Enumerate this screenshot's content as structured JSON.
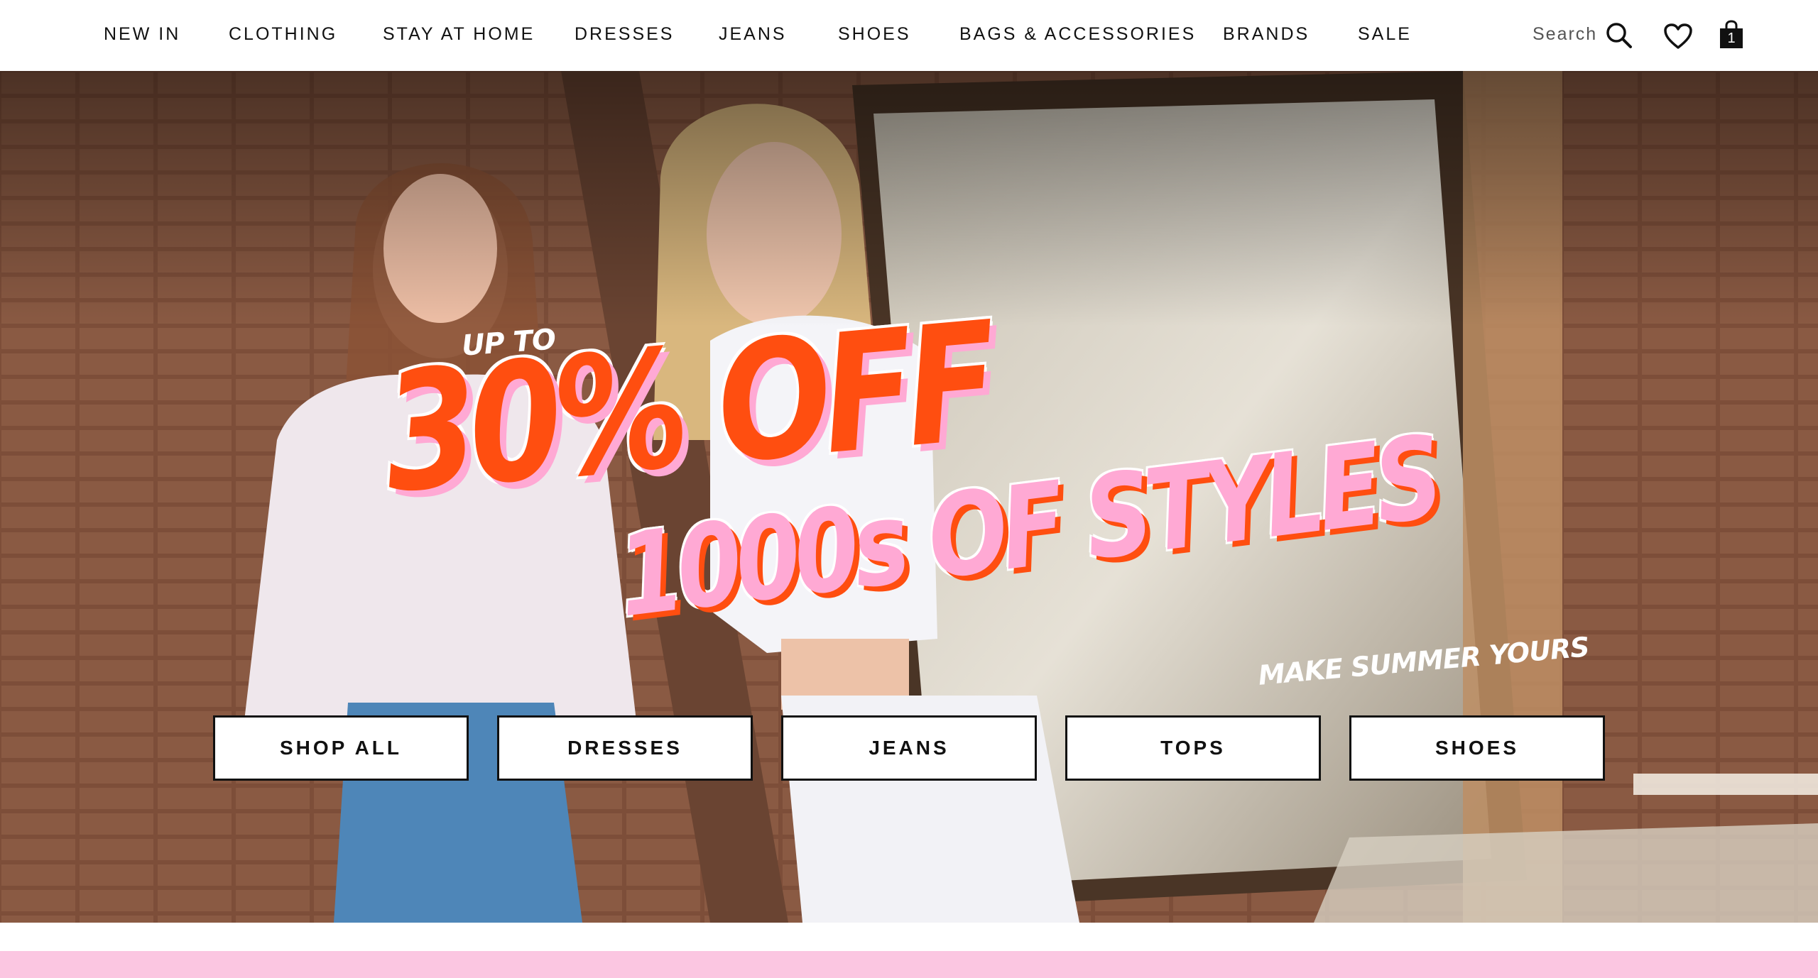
{
  "nav": {
    "items": [
      {
        "label": "NEW IN"
      },
      {
        "label": "CLOTHING"
      },
      {
        "label": "STAY AT HOME"
      },
      {
        "label": "DRESSES"
      },
      {
        "label": "JEANS"
      },
      {
        "label": "SHOES"
      },
      {
        "label": "BAGS & ACCESSORIES"
      },
      {
        "label": "BRANDS"
      },
      {
        "label": "SALE"
      }
    ],
    "search_label": "Search",
    "cart_count": "1",
    "icons": [
      "search-icon",
      "heart-icon",
      "bag-icon"
    ]
  },
  "hero": {
    "up_to": "UP TO",
    "headline_1": "30% OFF",
    "headline_2": "1000s OF STYLES",
    "tagline": "MAKE SUMMER YOURS",
    "buttons": [
      {
        "label": "SHOP ALL"
      },
      {
        "label": "DRESSES"
      },
      {
        "label": "JEANS"
      },
      {
        "label": "TOPS"
      },
      {
        "label": "SHOES"
      }
    ]
  },
  "colors": {
    "accent_orange": "#ff4e10",
    "accent_pink": "#ffa9d4",
    "strip_pink": "#fbc6e1",
    "text": "#111111"
  }
}
